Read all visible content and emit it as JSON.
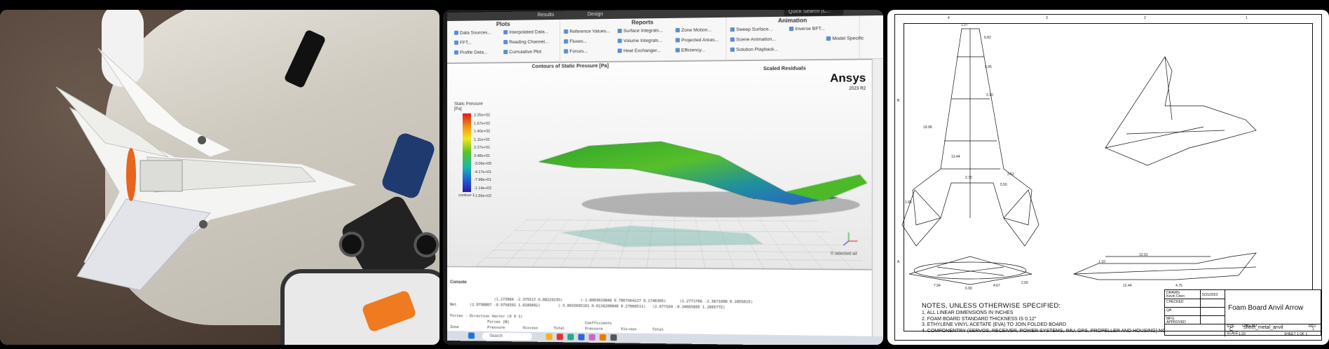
{
  "panels": [
    {
      "name": "photo-panel"
    },
    {
      "name": "ansys-screen-panel"
    },
    {
      "name": "drawing-panel"
    }
  ],
  "ansys": {
    "ribbon_tabs": [
      "Plots",
      "Reports",
      "Animation"
    ],
    "top_tabs": [
      "Results",
      "Design"
    ],
    "search_placeholder": "Quick Search (C...",
    "plots_items": [
      "Data Sources...",
      "Interpolated Data...",
      "FFT...",
      "Reading Channel...",
      "Profile Data...",
      "Cumulative Plot"
    ],
    "reports_items": [
      "Reference Values...",
      "Surface Integrals...",
      "Zone Motion...",
      "Fluxes...",
      "Volume Integrals...",
      "Projected Areas...",
      "Forces...",
      "Heat Exchanger...",
      "Efficiency..."
    ],
    "animation_items": [
      "Sweep Surface...",
      "Inverse BFT...",
      "Scene Animation...",
      "Solution Playback...",
      "Model Specific"
    ],
    "viewer_title": "Contours of Static Pressure [Pa]",
    "viewer_title2": "Scaled Residuals",
    "logo": "Ansys",
    "logo_version": "2023 R2",
    "legend_title": "Static Pressure\n[Pa]",
    "legend_values": [
      "2.25e+02",
      "1.67e+02",
      "1.40e+02",
      "1.11e+02",
      "2.27e+01",
      "3.48e+01",
      "-3.06e+00",
      "-4.17e+01",
      "-7.98e+01",
      "-1.14e+02",
      "-1.56e+02"
    ],
    "legend_footer": "contour-1",
    "selected": "0 selected  all",
    "console_title": "Console",
    "console_text": "                    (1.273984 -2.375517 0.88229235)        (-1.8003029848 0.7867664227 0.1746305)      (1.2771766 -2.3671998 0.1855815)\nNet      (2.0798807 -0.9758392 1.6189092)        (-3.0015695101 0.0116200848 0.27060511)   (2.677164 -0.34665895 1.2065772)\n\nForces - Direction Vector (0 0 1)\n                 Forces [N]                                  Coefficients\nZone             Pressure        Viscous       Total         Pressure        Viscous       Total\nplane            0.99023229      0.27140596    1.2616613     5.4140559       0.2108614     1.8607572\n\nNet              0.99023229      0.27140596    1.2616613     5.4140559       0.2108614     1.8607572",
    "taskbar_search": "Search"
  },
  "drawing": {
    "notes_title": "NOTES, UNLESS OTHERWISE SPECIFIED:",
    "notes": [
      "1. ALL LINEAR DIMENSIONS IN INCHES",
      "2. FOAM BOARD STANDARD THICKNESS IS 0.12\"",
      "3. ETHYLENE VINYL ACETATE (EVA) TO JOIN FOLDED BOARD",
      "4. COMPONENTRY (SERVOS, RECEIVER, POWER SYSTEMS, IMU, GPS, PROPELLER AND HOUSING) NOT SHOWN"
    ],
    "title": "Foam Board Anvil Arrow",
    "drawn_by": "Kevin Chen",
    "date": "5/31/2023",
    "size": "C",
    "dwg_no": "sheet_metal_anvil",
    "scale": "1:20",
    "sheet": "SHEET 1 OF 1",
    "rev": "1",
    "top_ticks": [
      "4",
      "3",
      "2",
      "1"
    ],
    "side_ticks": [
      "B",
      "A"
    ],
    "dims": [
      "1.57",
      "6.82",
      "5.95",
      "2.10",
      "1.85",
      "19.99",
      "13.44",
      "5.50",
      "2.70",
      "3.52",
      "12.91",
      "1.10",
      "12.44",
      "4.75",
      "2.00",
      "7.94",
      "6.90",
      "4.67"
    ],
    "title_labels": [
      "DRAWN",
      "CHECKED",
      "QA",
      "MFG",
      "APPROVED",
      "SIZE",
      "DWG NO",
      "REV",
      "SCALE"
    ]
  }
}
